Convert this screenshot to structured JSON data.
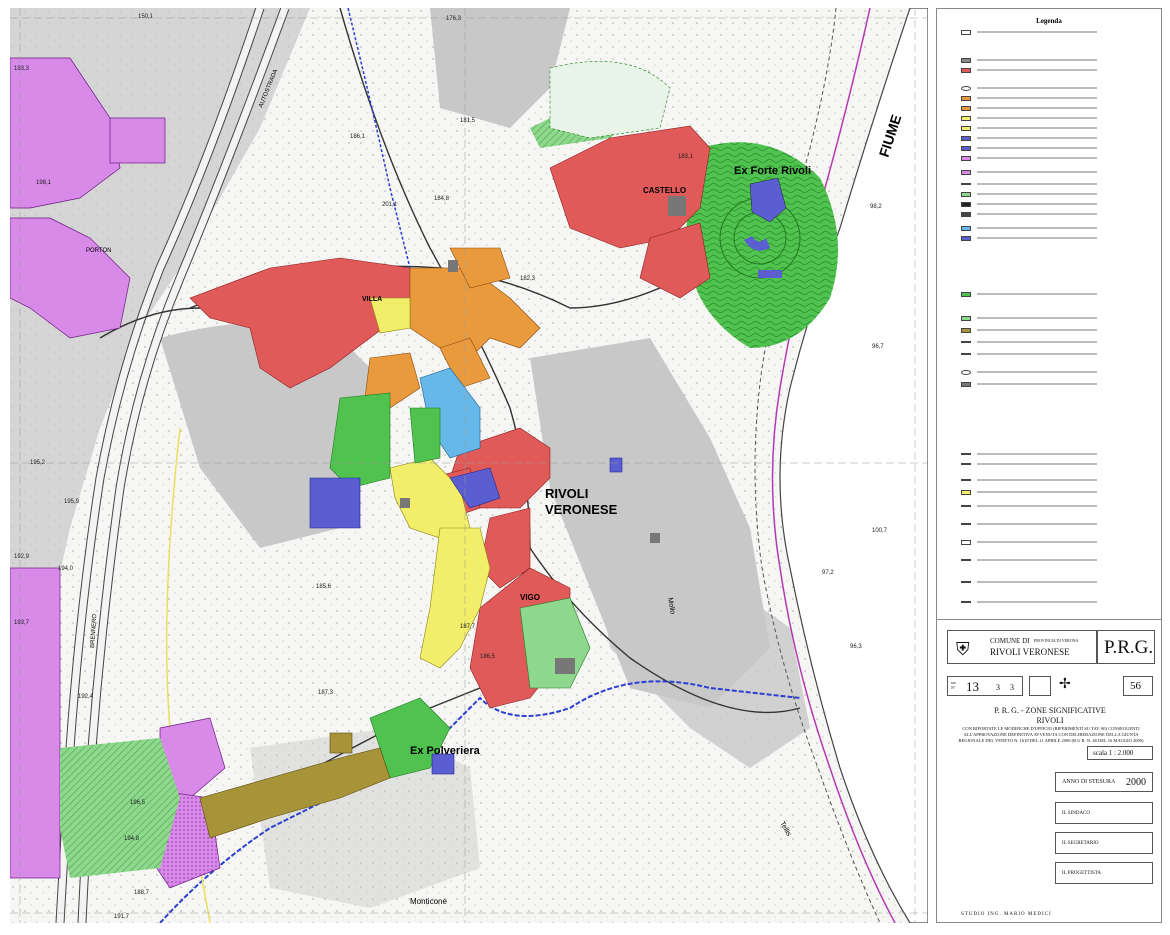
{
  "map": {
    "place_labels": {
      "forte": "Ex Forte Rivoli",
      "castello": "CASTELLO",
      "rivoli_line1": "RIVOLI",
      "rivoli_line2": "VERONESE",
      "polveriera": "Ex Polveriera",
      "vigo": "VIGO",
      "villa": "VILLA",
      "porton": "PORTON",
      "monticone": "Monticone",
      "fiume": "FIUME",
      "autostrada": "AUTOSTRADA",
      "brennero": "BRENNERO",
      "tellis": "Tellis",
      "mollo": "Mollo"
    },
    "elevations": [
      "150,1",
      "176,3",
      "195,2",
      "195,9",
      "198,1",
      "186,1",
      "181,5",
      "187,7",
      "193,3",
      "194,0",
      "192,9",
      "193,7",
      "192,4",
      "196,5",
      "194,8",
      "191,7",
      "188,7",
      "184,8",
      "183,1",
      "201,1",
      "98,2",
      "96,7",
      "100,7",
      "96,3",
      "97,2",
      "182,3",
      "187,3",
      "186,5",
      "185,6"
    ],
    "zone_colors": {
      "centro_storico": "#e05a5a",
      "completamento": "#e99a3c",
      "espansione": "#f3ee6a",
      "produttiva": "#5a5ed0",
      "verde": "#4fc24f",
      "servizi": "#66b8e8",
      "agricola": "#c8c8c8",
      "speciale": "#d88ae8",
      "sportiva": "#a89438",
      "river": "#ffffff",
      "green_hatch": "#8ed88e"
    }
  },
  "legend": {
    "title": "Legenda"
  },
  "title_block": {
    "comune_label": "COMUNE DI",
    "provincia": "PROVINCIA DI VERONA",
    "comune_name": "RIVOLI VERONESE",
    "prg": "P.R.G.",
    "tav_label": "tav. N°",
    "tav_number": "13",
    "tav_sub1": "3",
    "tav_sub2": "3",
    "page": "56",
    "subtitle1": "P. R. G. - ZONE SIGNIFICATIVE",
    "subtitle2": "RIVOLI",
    "note": "CON RIPORTATE LE MODIFICHE D'UFFICIO (RIFERIMENTI SU TAV. 00) CONSEGUENTI ALL'APPROVAZIONE DEFINITIVA AVVENUTA CON DELIBERAZIONE DELLA GIUNTA REGIONALE DEL VENETO N. 1618 DEL 11 APRILE 2000 (B.U.R. N. 46 DEL 16 MAGGIO 2000)",
    "scale": "scala   1 : 2.000",
    "anno_label": "ANNO DI STESURA",
    "anno_value": "2000",
    "sindaco": "IL SINDACO",
    "segretario": "IL SEGRETARIO",
    "progettista": "IL PROGETTISTA",
    "studio": "STUDIO ING. MARIO MEDICI"
  }
}
